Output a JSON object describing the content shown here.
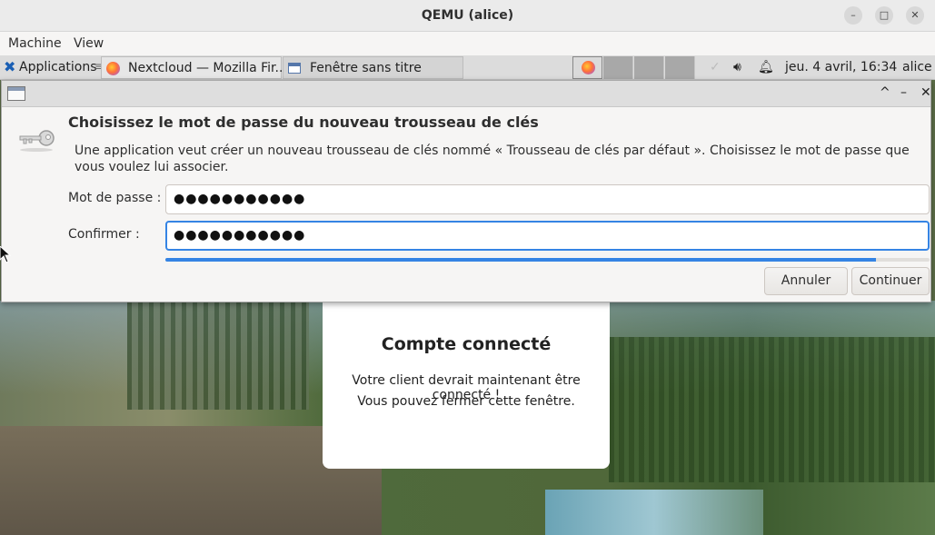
{
  "qemu": {
    "title": "QEMU (alice)",
    "menu": [
      "Machine",
      "View"
    ]
  },
  "panel": {
    "applications_label": "Applications",
    "applications_sep": "≡",
    "tasks": [
      {
        "label": "Nextcloud — Mozilla Fir...",
        "icon": "firefox-icon"
      },
      {
        "label": "Fenêtre sans titre",
        "icon": "window-icon"
      }
    ],
    "clock": "jeu.  4 avril, 16:34",
    "user": "alice"
  },
  "dialog": {
    "heading": "Choisissez le mot de passe du nouveau trousseau de clés",
    "description": "Une application veut créer un nouveau trousseau de clés nommé « Trousseau de clés par défaut ». Choisissez le mot de passe que vous voulez lui associer.",
    "password_label": "Mot de passe :",
    "password_value": "●●●●●●●●●●●",
    "confirm_label": "Confirmer :",
    "confirm_value": "●●●●●●●●●●●",
    "strength_fraction": 0.93,
    "cancel_label": "Annuler",
    "continue_label": "Continuer",
    "icon": "key-icon"
  },
  "card": {
    "title": "Compte connecté",
    "line1": "Votre client devrait maintenant être connecté !",
    "line2": "Vous pouvez fermer cette fenêtre."
  },
  "colors": {
    "accent": "#3584e4"
  }
}
